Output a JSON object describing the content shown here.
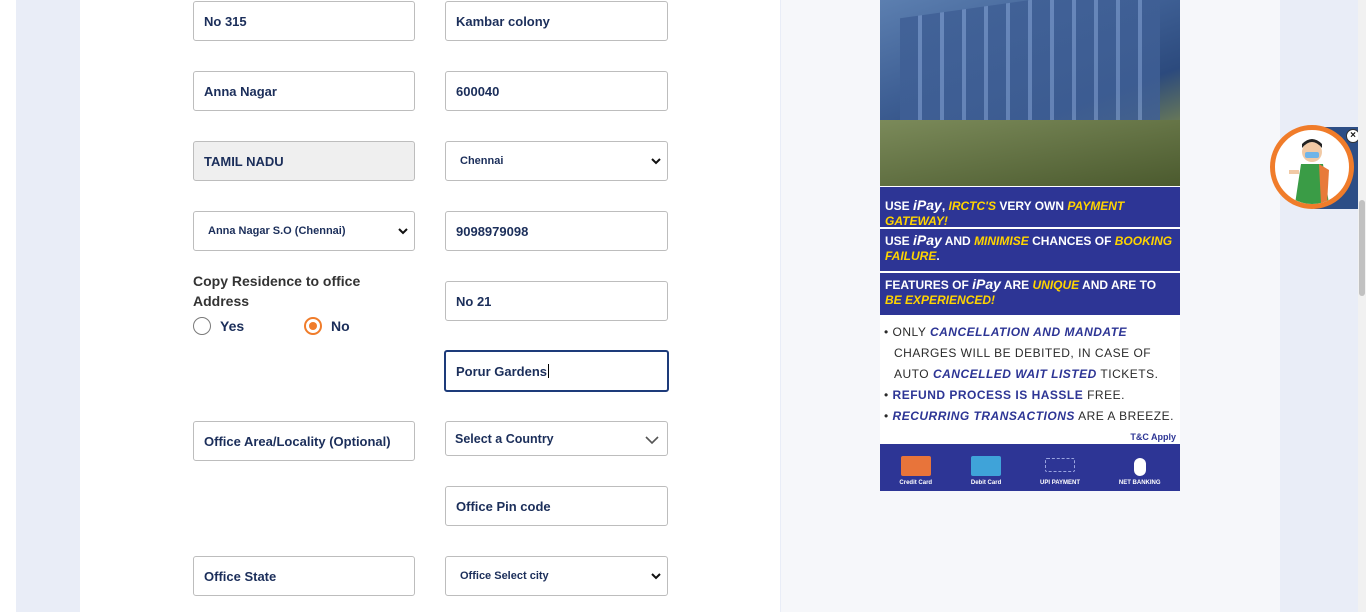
{
  "form": {
    "res_door": {
      "value": "No 315"
    },
    "res_street": {
      "value": "Kambar colony"
    },
    "res_area": {
      "value": "Anna Nagar"
    },
    "res_pincode": {
      "value": "600040"
    },
    "res_state": {
      "value": "TAMIL NADU"
    },
    "res_city": {
      "selected": "Chennai"
    },
    "res_post_office": {
      "selected": "Anna Nagar S.O (Chennai)"
    },
    "res_phone": {
      "value": "9098979098"
    },
    "copy_residence": {
      "label": "Copy Residence to office Address",
      "yes_label": "Yes",
      "no_label": "No",
      "selected": "No"
    },
    "office_door": {
      "value": "No 21"
    },
    "office_street": {
      "value": "Porur Gardens"
    },
    "office_area": {
      "placeholder": "Office Area/Locality (Optional)"
    },
    "office_country": {
      "selected": "Select a Country"
    },
    "office_pincode": {
      "placeholder": "Office Pin code"
    },
    "office_state": {
      "placeholder": "Office State"
    },
    "office_city": {
      "selected": "Office Select city"
    }
  },
  "ad": {
    "band1": {
      "pre": "USE ",
      "brand": "iPay",
      "mid": ", ",
      "irctc": "IRCTC'S",
      "post": " VERY OWN ",
      "hl": "PAYMENT GATEWAY!"
    },
    "band2": {
      "pre": "USE ",
      "brand": "iPay",
      "mid": " AND ",
      "hl1": "MINIMISE",
      "mid2": " CHANCES OF ",
      "hl2": "BOOKING FAILURE",
      "end": "."
    },
    "band3": {
      "pre": "FEATURES OF ",
      "brand": "iPay",
      "mid": " ARE ",
      "hl1": "UNIQUE",
      "mid2": " AND ARE TO ",
      "hl2": "BE EXPERIENCED!"
    },
    "bullets": {
      "b1_pre": "• ONLY ",
      "b1_hl": "CANCELLATION AND MANDATE",
      "b1_line2": "CHARGES WILL BE DEBITED, IN CASE OF",
      "b1_line3_pre": "AUTO ",
      "b1_line3_hl": "CANCELLED WAIT LISTED",
      "b1_line3_post": " TICKETS.",
      "b2_hl": "REFUND PROCESS IS HASSLE",
      "b2_post": " FREE.",
      "b3_hl": "RECURRING TRANSACTIONS",
      "b3_post": " ARE A BREEZE."
    },
    "tc": "T&C Apply",
    "payments": [
      {
        "label": "Credit Card",
        "icon": "credit-card-icon",
        "color": "#e8743a"
      },
      {
        "label": "Debit Card",
        "icon": "debit-card-icon",
        "color": "#3fa3d9"
      },
      {
        "label": "UPI PAYMENT",
        "icon": "upi-icon",
        "color": "#2d3595"
      },
      {
        "label": "NET BANKING",
        "icon": "mouse-icon",
        "color": "#2d3595"
      }
    ]
  },
  "assistant": {
    "close": "×"
  }
}
